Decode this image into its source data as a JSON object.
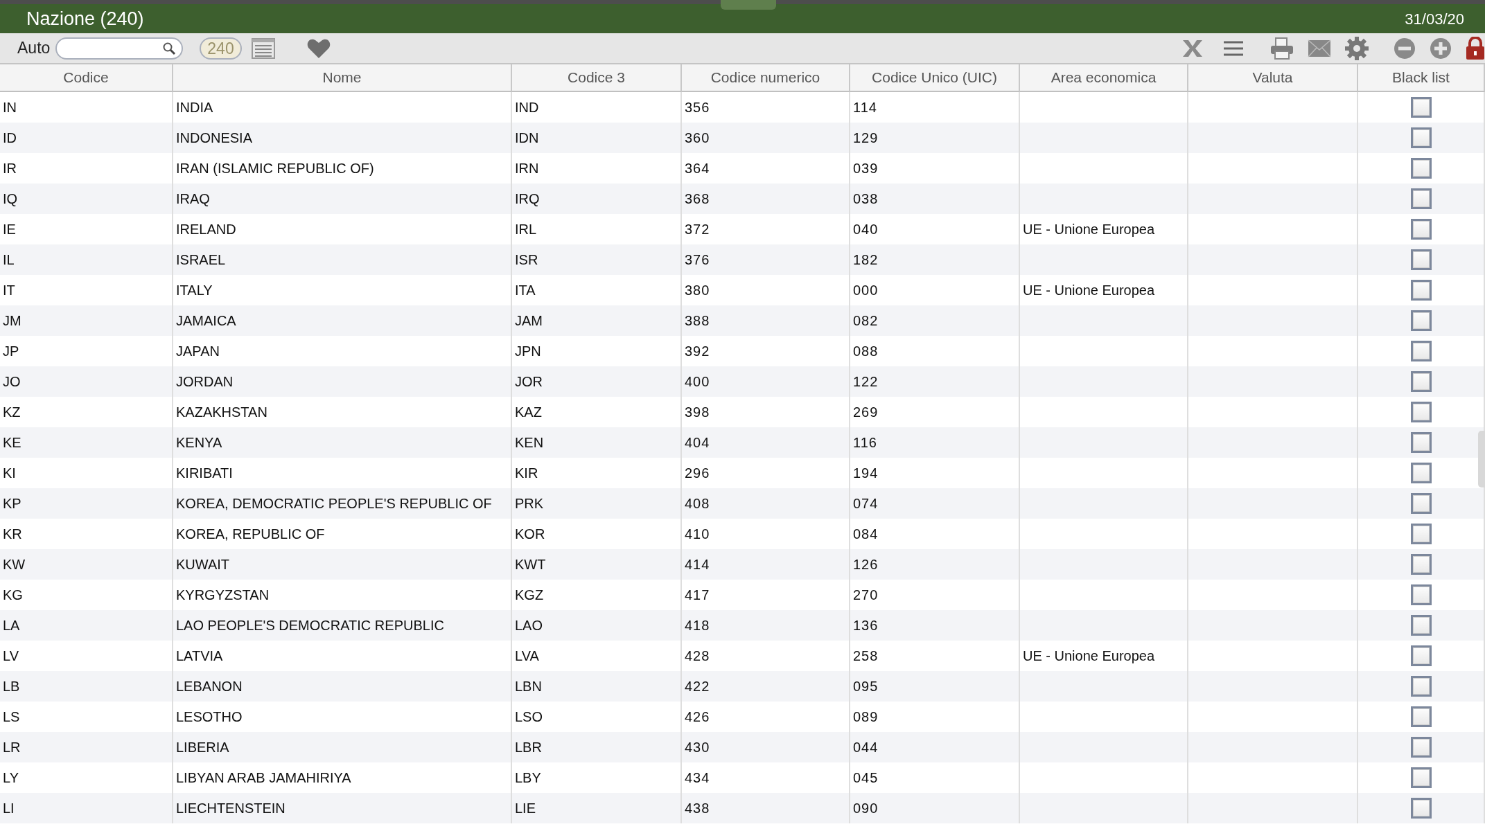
{
  "window": {
    "title": "Nazione (240)",
    "date": "31/03/20"
  },
  "toolbar": {
    "mode_label": "Auto",
    "count": "240"
  },
  "table": {
    "columns": [
      "Codice",
      "Nome",
      "Codice 3",
      "Codice numerico",
      "Codice Unico (UIC)",
      "Area economica",
      "Valuta",
      "Black list"
    ],
    "rows": [
      {
        "codice": "IN",
        "nome": "INDIA",
        "codice_3": "IND",
        "codice_numerico": "356",
        "codice_uic": "114",
        "black_list": false
      },
      {
        "codice": "ID",
        "nome": "INDONESIA",
        "codice_3": "IDN",
        "codice_numerico": "360",
        "codice_uic": "129",
        "black_list": false
      },
      {
        "codice": "IR",
        "nome": "IRAN (ISLAMIC REPUBLIC OF)",
        "codice_3": "IRN",
        "codice_numerico": "364",
        "codice_uic": "039",
        "black_list": false
      },
      {
        "codice": "IQ",
        "nome": "IRAQ",
        "codice_3": "IRQ",
        "codice_numerico": "368",
        "codice_uic": "038",
        "black_list": false
      },
      {
        "codice": "IE",
        "nome": "IRELAND",
        "codice_3": "IRL",
        "codice_numerico": "372",
        "codice_uic": "040",
        "area_economica": "UE - Unione Europea",
        "black_list": false
      },
      {
        "codice": "IL",
        "nome": "ISRAEL",
        "codice_3": "ISR",
        "codice_numerico": "376",
        "codice_uic": "182",
        "black_list": false
      },
      {
        "codice": "IT",
        "nome": "ITALY",
        "codice_3": "ITA",
        "codice_numerico": "380",
        "codice_uic": "000",
        "area_economica": "UE - Unione Europea",
        "black_list": false
      },
      {
        "codice": "JM",
        "nome": "JAMAICA",
        "codice_3": "JAM",
        "codice_numerico": "388",
        "codice_uic": "082",
        "black_list": false
      },
      {
        "codice": "JP",
        "nome": "JAPAN",
        "codice_3": "JPN",
        "codice_numerico": "392",
        "codice_uic": "088",
        "black_list": false
      },
      {
        "codice": "JO",
        "nome": "JORDAN",
        "codice_3": "JOR",
        "codice_numerico": "400",
        "codice_uic": "122",
        "black_list": false
      },
      {
        "codice": "KZ",
        "nome": "KAZAKHSTAN",
        "codice_3": "KAZ",
        "codice_numerico": "398",
        "codice_uic": "269",
        "black_list": false
      },
      {
        "codice": "KE",
        "nome": "KENYA",
        "codice_3": "KEN",
        "codice_numerico": "404",
        "codice_uic": "116",
        "black_list": false
      },
      {
        "codice": "KI",
        "nome": "KIRIBATI",
        "codice_3": "KIR",
        "codice_numerico": "296",
        "codice_uic": "194",
        "black_list": false
      },
      {
        "codice": "KP",
        "nome": "KOREA, DEMOCRATIC PEOPLE'S REPUBLIC OF",
        "codice_3": "PRK",
        "codice_numerico": "408",
        "codice_uic": "074",
        "black_list": false
      },
      {
        "codice": "KR",
        "nome": "KOREA, REPUBLIC OF",
        "codice_3": "KOR",
        "codice_numerico": "410",
        "codice_uic": "084",
        "black_list": false
      },
      {
        "codice": "KW",
        "nome": "KUWAIT",
        "codice_3": "KWT",
        "codice_numerico": "414",
        "codice_uic": "126",
        "black_list": false
      },
      {
        "codice": "KG",
        "nome": "KYRGYZSTAN",
        "codice_3": "KGZ",
        "codice_numerico": "417",
        "codice_uic": "270",
        "black_list": false
      },
      {
        "codice": "LA",
        "nome": "LAO PEOPLE'S DEMOCRATIC REPUBLIC",
        "codice_3": "LAO",
        "codice_numerico": "418",
        "codice_uic": "136",
        "black_list": false
      },
      {
        "codice": "LV",
        "nome": "LATVIA",
        "codice_3": "LVA",
        "codice_numerico": "428",
        "codice_uic": "258",
        "area_economica": "UE - Unione Europea",
        "black_list": false
      },
      {
        "codice": "LB",
        "nome": "LEBANON",
        "codice_3": "LBN",
        "codice_numerico": "422",
        "codice_uic": "095",
        "black_list": false
      },
      {
        "codice": "LS",
        "nome": "LESOTHO",
        "codice_3": "LSO",
        "codice_numerico": "426",
        "codice_uic": "089",
        "black_list": false
      },
      {
        "codice": "LR",
        "nome": "LIBERIA",
        "codice_3": "LBR",
        "codice_numerico": "430",
        "codice_uic": "044",
        "black_list": false
      },
      {
        "codice": "LY",
        "nome": "LIBYAN ARAB JAMAHIRIYA",
        "codice_3": "LBY",
        "codice_numerico": "434",
        "codice_uic": "045",
        "black_list": false
      },
      {
        "codice": "LI",
        "nome": "LIECHTENSTEIN",
        "codice_3": "LIE",
        "codice_numerico": "438",
        "codice_uic": "090",
        "black_list": false
      }
    ]
  }
}
